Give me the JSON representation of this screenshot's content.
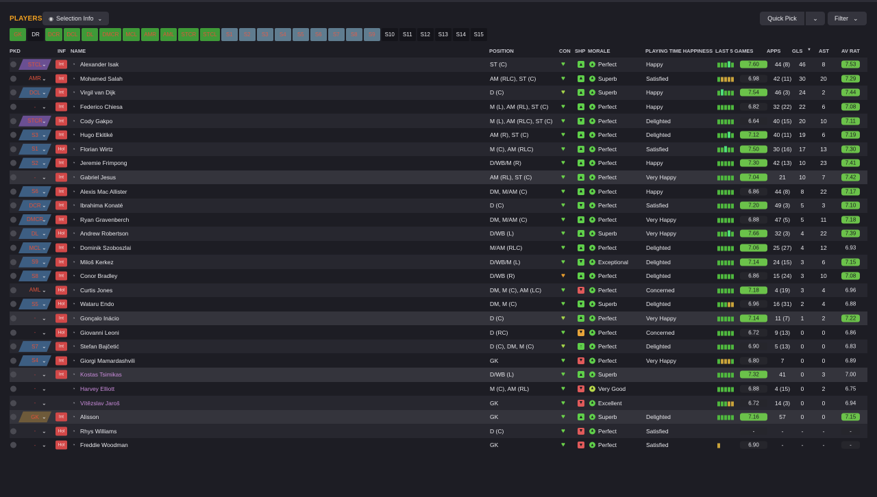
{
  "header": {
    "title": "PLAYERS",
    "selection_info": "Selection Info",
    "quick_pick": "Quick Pick",
    "filter": "Filter"
  },
  "chips": [
    {
      "label": "GK",
      "style": "green"
    },
    {
      "label": "DR",
      "style": "black"
    },
    {
      "label": "DCR",
      "style": "green"
    },
    {
      "label": "DCL",
      "style": "green"
    },
    {
      "label": "DL",
      "style": "green"
    },
    {
      "label": "DMCR",
      "style": "green"
    },
    {
      "label": "MCL",
      "style": "green"
    },
    {
      "label": "AMR",
      "style": "green"
    },
    {
      "label": "AML",
      "style": "green"
    },
    {
      "label": "STCR",
      "style": "green"
    },
    {
      "label": "STCL",
      "style": "green"
    },
    {
      "label": "S1",
      "style": "gray"
    },
    {
      "label": "S2",
      "style": "gray"
    },
    {
      "label": "S3",
      "style": "gray"
    },
    {
      "label": "S4",
      "style": "gray"
    },
    {
      "label": "S5",
      "style": "gray"
    },
    {
      "label": "S6",
      "style": "gray"
    },
    {
      "label": "S7",
      "style": "gray"
    },
    {
      "label": "S8",
      "style": "gray"
    },
    {
      "label": "S9",
      "style": "gray"
    },
    {
      "label": "S10",
      "style": "black"
    },
    {
      "label": "S11",
      "style": "black"
    },
    {
      "label": "S12",
      "style": "black"
    },
    {
      "label": "S13",
      "style": "black"
    },
    {
      "label": "S14",
      "style": "black"
    },
    {
      "label": "S15",
      "style": "black"
    }
  ],
  "columns": {
    "pkd": "PKD",
    "inf": "INF",
    "name": "NAME",
    "position": "POSITION",
    "con": "CON",
    "shp": "SHP",
    "morale": "MORALE",
    "pth": "PLAYING TIME HAPPINESS",
    "last5": "LAST 5 GAMES",
    "apps": "APPS",
    "gls": "GLS",
    "ast": "AST",
    "avrat": "AV RAT"
  },
  "colors": {
    "green": "#6bc24a",
    "chip_green": "#3f9a38",
    "chip_gray": "#5f7c8f",
    "loan_name": "#c78ad8",
    "inf_red": "#d24848"
  },
  "rows": [
    {
      "pkd": "STCL",
      "pkdc": "#6a4f92",
      "inf": "Int",
      "name": "Alexander Isak",
      "pos": "ST (C)",
      "shp": "up",
      "morale": "Perfect",
      "pth": "Happy",
      "form": "gggGg",
      "rat": "7.60",
      "rg": true,
      "apps": "44 (8)",
      "gls": "46",
      "ast": "8",
      "avr": "7.53",
      "ag": true
    },
    {
      "pkd": "AMR",
      "pkdc": "",
      "inf": "Int",
      "name": "Mohamed Salah",
      "pos": "AM (RLC), ST (C)",
      "shp": "up",
      "morale": "Superb",
      "pth": "Satisfied",
      "form": "goooo",
      "rat": "6.98",
      "rg": false,
      "apps": "42 (11)",
      "gls": "30",
      "ast": "20",
      "avr": "7.29",
      "ag": true
    },
    {
      "pkd": "DCL",
      "pkdc": "#3d5e82",
      "inf": "Int",
      "name": "Virgil van Dijk",
      "pos": "D (C)",
      "shp": "up",
      "morale": "Superb",
      "pth": "Happy",
      "form": "gGggg",
      "rat": "7.54",
      "rg": true,
      "apps": "46 (3)",
      "gls": "24",
      "ast": "2",
      "avr": "7.44",
      "ag": true
    },
    {
      "pkd": "-",
      "pkdc": "",
      "inf": "Int",
      "name": "Federico Chiesa",
      "pos": "M (L), AM (RL), ST (C)",
      "shp": "up",
      "morale": "Perfect",
      "pth": "Happy",
      "form": "ggggg",
      "rat": "6.82",
      "rg": false,
      "apps": "32 (22)",
      "gls": "22",
      "ast": "6",
      "avr": "7.08",
      "ag": true
    },
    {
      "pkd": "STCR",
      "pkdc": "#6a4f92",
      "inf": "Int",
      "name": "Cody Gakpo",
      "pos": "M (L), AM (RLC), ST (C)",
      "shp": "down",
      "morale": "Perfect",
      "pth": "Delighted",
      "form": "ggggg",
      "rat": "6.64",
      "rg": false,
      "apps": "40 (15)",
      "gls": "20",
      "ast": "10",
      "avr": "7.11",
      "ag": true
    },
    {
      "pkd": "S3",
      "pkdc": "#3d5e82",
      "inf": "Int",
      "name": "Hugo Ekitiké",
      "pos": "AM (R), ST (C)",
      "shp": "up",
      "morale": "Perfect",
      "pth": "Delighted",
      "form": "gggGg",
      "rat": "7.12",
      "rg": true,
      "apps": "40 (11)",
      "gls": "19",
      "ast": "6",
      "avr": "7.19",
      "ag": true
    },
    {
      "pkd": "S1",
      "pkdc": "#3d5e82",
      "inf": "Hol",
      "name": "Florian Wirtz",
      "pos": "M (C), AM (RLC)",
      "shp": "up",
      "morale": "Perfect",
      "pth": "Satisfied",
      "form": "ggGgg",
      "rat": "7.50",
      "rg": true,
      "apps": "30 (16)",
      "gls": "17",
      "ast": "13",
      "avr": "7.30",
      "ag": true
    },
    {
      "pkd": "S2",
      "pkdc": "#3d5e82",
      "inf": "Int",
      "name": "Jeremie Frimpong",
      "pos": "D/WB/M (R)",
      "shp": "up",
      "morale": "Perfect",
      "pth": "Happy",
      "form": "ggggg",
      "rat": "7.30",
      "rg": true,
      "apps": "42 (13)",
      "gls": "10",
      "ast": "23",
      "avr": "7.41",
      "ag": true
    },
    {
      "pkd": "-",
      "pkdc": "",
      "inf": "Int",
      "name": "Gabriel Jesus",
      "pos": "AM (RL), ST (C)",
      "shp": "up",
      "morale": "Perfect",
      "pth": "Very Happy",
      "form": "ggggg",
      "rat": "7.04",
      "rg": true,
      "apps": "21",
      "gls": "10",
      "ast": "7",
      "avr": "7.42",
      "ag": true
    },
    {
      "pkd": "S6",
      "pkdc": "#3d5e82",
      "inf": "Int",
      "name": "Alexis Mac Allister",
      "pos": "DM, M/AM (C)",
      "shp": "up",
      "morale": "Perfect",
      "pth": "Happy",
      "form": "ggggg",
      "rat": "6.86",
      "rg": false,
      "apps": "44 (8)",
      "gls": "8",
      "ast": "22",
      "avr": "7.17",
      "ag": true
    },
    {
      "pkd": "DCR",
      "pkdc": "#3d5e82",
      "inf": "Int",
      "name": "Ibrahima Konaté",
      "pos": "D (C)",
      "shp": "down",
      "morale": "Perfect",
      "pth": "Satisfied",
      "form": "ggggg",
      "rat": "7.20",
      "rg": true,
      "apps": "49 (3)",
      "gls": "5",
      "ast": "3",
      "avr": "7.10",
      "ag": true
    },
    {
      "pkd": "DMCR",
      "pkdc": "#3d5e82",
      "inf": "Int",
      "name": "Ryan Gravenberch",
      "pos": "DM, M/AM (C)",
      "shp": "up",
      "morale": "Perfect",
      "pth": "Very Happy",
      "form": "ggggg",
      "rat": "6.88",
      "rg": false,
      "apps": "47 (5)",
      "gls": "5",
      "ast": "11",
      "avr": "7.18",
      "ag": true
    },
    {
      "pkd": "DL",
      "pkdc": "#3d5e82",
      "inf": "Hol",
      "name": "Andrew Robertson",
      "pos": "D/WB (L)",
      "shp": "up",
      "morale": "Superb",
      "pth": "Very Happy",
      "form": "gggGg",
      "rat": "7.66",
      "rg": true,
      "apps": "32 (3)",
      "gls": "4",
      "ast": "22",
      "avr": "7.39",
      "ag": true
    },
    {
      "pkd": "MCL",
      "pkdc": "#3d5e82",
      "inf": "Int",
      "name": "Dominik Szoboszlai",
      "pos": "M/AM (RLC)",
      "shp": "up",
      "morale": "Perfect",
      "pth": "Delighted",
      "form": "ggggg",
      "rat": "7.06",
      "rg": true,
      "apps": "25 (27)",
      "gls": "4",
      "ast": "12",
      "avr": "6.93",
      "ag": false
    },
    {
      "pkd": "S9",
      "pkdc": "#3d5e82",
      "inf": "Int",
      "name": "Miloš Kerkez",
      "pos": "D/WB/M (L)",
      "shp": "down",
      "morale": "Exceptional",
      "pth": "Delighted",
      "form": "ggggg",
      "rat": "7.14",
      "rg": true,
      "apps": "24 (15)",
      "gls": "3",
      "ast": "6",
      "avr": "7.15",
      "ag": true
    },
    {
      "pkd": "S8",
      "pkdc": "#3d5e82",
      "inf": "Int",
      "name": "Conor Bradley",
      "pos": "D/WB (R)",
      "shp": "up",
      "morale": "Perfect",
      "pth": "Delighted",
      "form": "ggggg",
      "rat": "6.86",
      "rg": false,
      "apps": "15 (24)",
      "gls": "3",
      "ast": "10",
      "avr": "7.08",
      "ag": true
    },
    {
      "pkd": "AML",
      "pkdc": "",
      "inf": "Hol",
      "name": "Curtis Jones",
      "pos": "DM, M (C), AM (LC)",
      "shp": "red",
      "morale": "Perfect",
      "pth": "Concerned",
      "form": "ggggg",
      "rat": "7.18",
      "rg": true,
      "apps": "4 (19)",
      "gls": "3",
      "ast": "4",
      "avr": "6.96",
      "ag": false
    },
    {
      "pkd": "S5",
      "pkdc": "#3d5e82",
      "inf": "Hol",
      "name": "Wataru Endo",
      "pos": "DM, M (C)",
      "shp": "down",
      "morale": "Superb",
      "pth": "Delighted",
      "form": "gggoo",
      "rat": "6.96",
      "rg": false,
      "apps": "16 (31)",
      "gls": "2",
      "ast": "4",
      "avr": "6.88",
      "ag": false
    },
    {
      "pkd": "-",
      "pkdc": "",
      "inf": "Int",
      "name": "Gonçalo Inácio",
      "pos": "D (C)",
      "shp": "up",
      "morale": "Perfect",
      "pth": "Very Happy",
      "form": "ggggg",
      "rat": "7.14",
      "rg": true,
      "apps": "11 (7)",
      "gls": "1",
      "ast": "2",
      "avr": "7.22",
      "ag": true
    },
    {
      "pkd": "-",
      "pkdc": "",
      "inf": "Hol",
      "name": "Giovanni Leoni",
      "pos": "D (RC)",
      "shp": "amber",
      "morale": "Perfect",
      "pth": "Concerned",
      "form": "ggggg",
      "rat": "6.72",
      "rg": false,
      "apps": "9 (13)",
      "gls": "0",
      "ast": "0",
      "avr": "6.86",
      "ag": false
    },
    {
      "pkd": "S7",
      "pkdc": "#3d5e82",
      "inf": "Int",
      "name": "Stefan Bajčetić",
      "pos": "D (C), DM, M (C)",
      "shp": "upline",
      "morale": "Perfect",
      "pth": "Delighted",
      "form": "ggggg",
      "rat": "6.90",
      "rg": false,
      "apps": "5 (13)",
      "gls": "0",
      "ast": "0",
      "avr": "6.83",
      "ag": false
    },
    {
      "pkd": "S4",
      "pkdc": "#3d5e82",
      "inf": "Int",
      "name": "Giorgi Mamardashvili",
      "pos": "GK",
      "shp": "red",
      "morale": "Perfect",
      "pth": "Very Happy",
      "form": "gooog",
      "rat": "6.80",
      "rg": false,
      "apps": "7",
      "gls": "0",
      "ast": "0",
      "avr": "6.89",
      "ag": false
    },
    {
      "pkd": "-",
      "pkdc": "",
      "inf": "Int",
      "name": "Kostas Tsimikas",
      "pos": "D/WB (L)",
      "shp": "up",
      "morale": "Superb",
      "pth": "",
      "form": "ggggg",
      "rat": "7.32",
      "rg": true,
      "apps": "41",
      "gls": "0",
      "ast": "3",
      "avr": "7.00",
      "ag": false,
      "loan": true
    },
    {
      "pkd": "-",
      "pkdc": "",
      "inf": "",
      "name": "Harvey Elliott",
      "pos": "M (C), AM (RL)",
      "shp": "red",
      "morale": "Very Good",
      "pth": "",
      "form": "ggggg",
      "rat": "6.88",
      "rg": false,
      "apps": "4 (15)",
      "gls": "0",
      "ast": "2",
      "avr": "6.75",
      "ag": false,
      "loan": true
    },
    {
      "pkd": "-",
      "pkdc": "",
      "inf": "",
      "name": "Vítězslav Jaroš",
      "pos": "GK",
      "shp": "red",
      "morale": "Excellent",
      "pth": "",
      "form": "gggoo",
      "rat": "6.72",
      "rg": false,
      "apps": "14 (3)",
      "gls": "0",
      "ast": "0",
      "avr": "6.94",
      "ag": false,
      "loan": true
    },
    {
      "pkd": "GK",
      "pkdc": "#6e5a3a",
      "inf": "Int",
      "name": "Alisson",
      "pos": "GK",
      "shp": "up",
      "morale": "Superb",
      "pth": "Delighted",
      "form": "ggggg",
      "rat": "7.16",
      "rg": true,
      "apps": "57",
      "gls": "0",
      "ast": "0",
      "avr": "7.15",
      "ag": true
    },
    {
      "pkd": "-",
      "pkdc": "",
      "inf": "Hol",
      "name": "Rhys Williams",
      "pos": "D (C)",
      "shp": "red",
      "morale": "Perfect",
      "pth": "Satisfied",
      "form": "",
      "rat": "-",
      "rg": false,
      "apps": "-",
      "gls": "-",
      "ast": "-",
      "avr": "-",
      "ag": false
    },
    {
      "pkd": "-",
      "pkdc": "",
      "inf": "Hol",
      "name": "Freddie Woodman",
      "pos": "GK",
      "shp": "red",
      "morale": "Perfect",
      "pth": "Satisfied",
      "form": "o",
      "rat": "6.90",
      "rg": false,
      "apps": "-",
      "gls": "-",
      "ast": "-",
      "avr": "-",
      "ag": false
    }
  ]
}
